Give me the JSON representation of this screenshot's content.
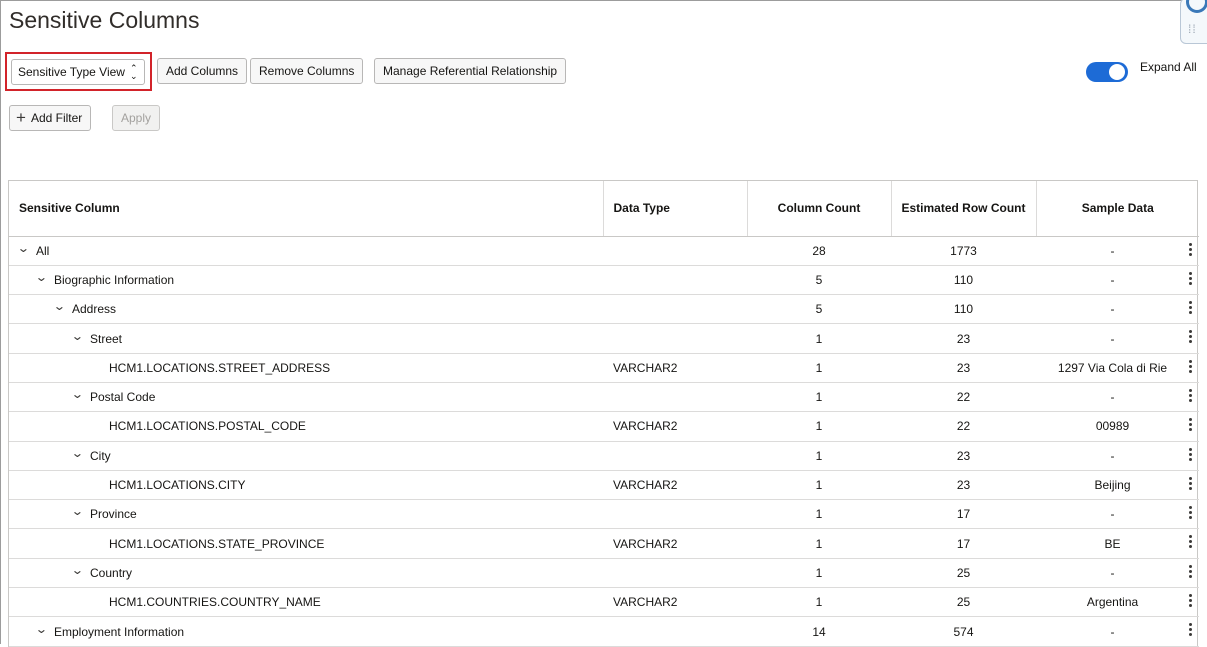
{
  "page": {
    "title": "Sensitive Columns"
  },
  "toolbar": {
    "view_select": "Sensitive Type View",
    "add_columns": "Add Columns",
    "remove_columns": "Remove Columns",
    "manage_referential": "Manage Referential Relationship",
    "expand_all_label": "Expand All",
    "expand_all_on": true
  },
  "filters": {
    "add_filter": "Add Filter",
    "apply": "Apply"
  },
  "table": {
    "headers": {
      "sensitive_column": "Sensitive Column",
      "data_type": "Data Type",
      "column_count": "Column Count",
      "estimated_row_count": "Estimated Row Count",
      "sample_data": "Sample Data"
    },
    "rows": [
      {
        "level": 0,
        "expandable": true,
        "name": "All",
        "type": "",
        "count": "28",
        "rows": "1773",
        "sample": "-"
      },
      {
        "level": 1,
        "expandable": true,
        "name": "Biographic Information",
        "type": "",
        "count": "5",
        "rows": "110",
        "sample": "-"
      },
      {
        "level": 2,
        "expandable": true,
        "name": "Address",
        "type": "",
        "count": "5",
        "rows": "110",
        "sample": "-"
      },
      {
        "level": 3,
        "expandable": true,
        "name": "Street",
        "type": "",
        "count": "1",
        "rows": "23",
        "sample": "-"
      },
      {
        "level": 4,
        "expandable": false,
        "name": "HCM1.LOCATIONS.STREET_ADDRESS",
        "type": "VARCHAR2",
        "count": "1",
        "rows": "23",
        "sample": "1297 Via Cola di Rie"
      },
      {
        "level": 3,
        "expandable": true,
        "name": "Postal Code",
        "type": "",
        "count": "1",
        "rows": "22",
        "sample": "-"
      },
      {
        "level": 4,
        "expandable": false,
        "name": "HCM1.LOCATIONS.POSTAL_CODE",
        "type": "VARCHAR2",
        "count": "1",
        "rows": "22",
        "sample": "00989"
      },
      {
        "level": 3,
        "expandable": true,
        "name": "City",
        "type": "",
        "count": "1",
        "rows": "23",
        "sample": "-"
      },
      {
        "level": 4,
        "expandable": false,
        "name": "HCM1.LOCATIONS.CITY",
        "type": "VARCHAR2",
        "count": "1",
        "rows": "23",
        "sample": "Beijing"
      },
      {
        "level": 3,
        "expandable": true,
        "name": "Province",
        "type": "",
        "count": "1",
        "rows": "17",
        "sample": "-"
      },
      {
        "level": 4,
        "expandable": false,
        "name": "HCM1.LOCATIONS.STATE_PROVINCE",
        "type": "VARCHAR2",
        "count": "1",
        "rows": "17",
        "sample": "BE"
      },
      {
        "level": 3,
        "expandable": true,
        "name": "Country",
        "type": "",
        "count": "1",
        "rows": "25",
        "sample": "-"
      },
      {
        "level": 4,
        "expandable": false,
        "name": "HCM1.COUNTRIES.COUNTRY_NAME",
        "type": "VARCHAR2",
        "count": "1",
        "rows": "25",
        "sample": "Argentina"
      },
      {
        "level": 1,
        "expandable": true,
        "name": "Employment Information",
        "type": "",
        "count": "14",
        "rows": "574",
        "sample": "-"
      }
    ]
  },
  "colors": {
    "accent": "#1d6bd6",
    "highlight_border": "#d2232a"
  },
  "icons": {
    "expand": "chevron-down-icon",
    "row_menu": "kebab-menu-icon",
    "add": "plus-icon",
    "select": "updown-icon"
  }
}
